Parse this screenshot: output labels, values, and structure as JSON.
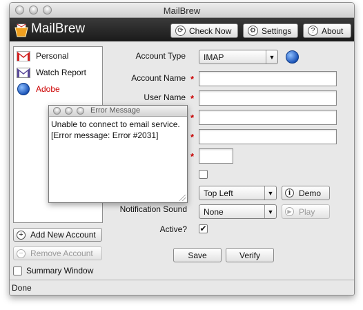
{
  "window": {
    "title": "MailBrew"
  },
  "app": {
    "name": "MailBrew"
  },
  "toolbar": {
    "check_now": "Check Now",
    "settings": "Settings",
    "about": "About"
  },
  "accounts": [
    {
      "name": "Personal",
      "icon": "gmail-icon"
    },
    {
      "name": "Watch Report",
      "icon": "mail-icon"
    },
    {
      "name": "Adobe",
      "icon": "globe-icon",
      "color": "#cc0000"
    }
  ],
  "sidebar": {
    "add_account": "Add New Account",
    "remove_account": "Remove Account",
    "summary_window": "Summary Window"
  },
  "form": {
    "account_type_label": "Account Type",
    "account_type_value": "IMAP",
    "account_name_label": "Account Name",
    "user_name_label": "User Name",
    "notification_position_value": "Top Left",
    "demo_label": "Demo",
    "notification_sound_label": "Notification Sound",
    "notification_sound_value": "None",
    "play_label": "Play",
    "active_label": "Active?",
    "active_checked": "✔",
    "save_label": "Save",
    "verify_label": "Verify"
  },
  "error_dialog": {
    "title": "Error Message",
    "line1": "Unable to connect to email service.",
    "line2": "[Error message: Error #2031]"
  },
  "status": {
    "text": "Done"
  }
}
